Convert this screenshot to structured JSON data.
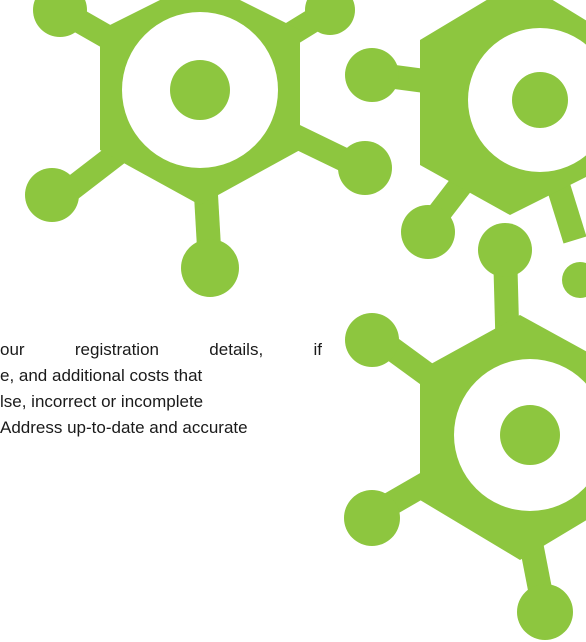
{
  "document": {
    "lines": [
      "our  registration  details,  if",
      "e, and additional costs that",
      "lse, incorrect or incomplete",
      "Address up-to-date and accurate"
    ]
  },
  "decoration": {
    "molecule_color": "#8dc63f",
    "background_color": "#ffffff"
  }
}
